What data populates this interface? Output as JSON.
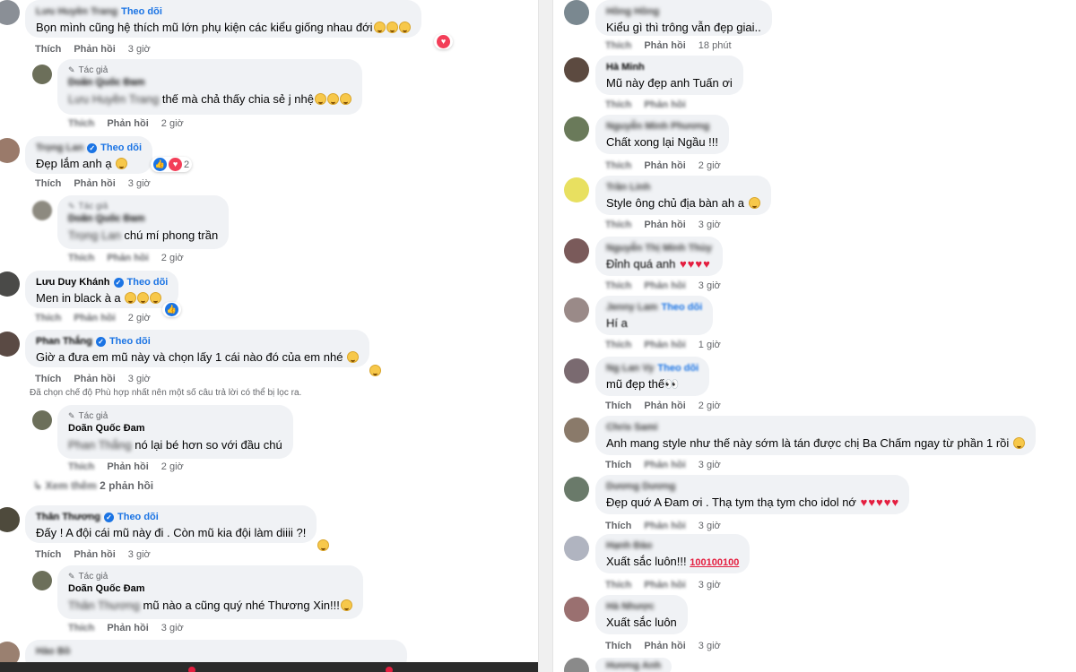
{
  "actions": {
    "like": "Thích",
    "reply": "Phản hồi"
  },
  "follow_label": "Theo dõi",
  "author_label": "Tác giả",
  "left": {
    "c1": {
      "name": "Lưu Huyền Trang",
      "text": "Bọn mình cũng hệ thích mũ lớn phụ kiện các kiểu giống nhau đới",
      "time": "3 giờ"
    },
    "r1": {
      "name": "Doãn Quốc Đam",
      "mention": "Lưu Huyền Trang",
      "text": "thế mà chả thấy chia sẻ j nhệ",
      "time": "2 giờ"
    },
    "c2": {
      "name": "Trọng Lan",
      "text": "Đẹp lắm anh ạ",
      "time": "3 giờ",
      "react_count": "2"
    },
    "r2": {
      "name": "Doãn Quốc Đam",
      "mention": "Trọng Lan",
      "text": "chú mí phong trần",
      "time": "2 giờ"
    },
    "c3": {
      "name": "Lưu Duy Khánh",
      "text": "Men in black à a",
      "time": "2 giờ"
    },
    "c4": {
      "name": "Phan Thắng",
      "text": "Giờ a đưa em mũ này và chọn lấy 1 cái nào đó của em nhé",
      "time": "3 giờ"
    },
    "note": "Đã chọn chế độ Phù hợp nhất nên một số câu trả lời có thể bị lọc ra.",
    "r4": {
      "name": "Doãn Quốc Đam",
      "mention": "Phan Thắng",
      "text": "nó lại bé hơn so với đầu chú",
      "time": "2 giờ"
    },
    "more": {
      "prefix": "Xem thêm",
      "count": "2 phản hồi"
    },
    "c5": {
      "name": "Thân Thương",
      "text": "Đấy ! A đội cái mũ này đi . Còn mũ kia đội làm diiii ?!",
      "time": "3 giờ"
    },
    "r5": {
      "name": "Doãn Quốc Đam",
      "mention": "Thân Thương",
      "text": "mũ nào a cũng quý nhé Thương Xin!!!",
      "time": "3 giờ"
    },
    "c6": {
      "name": "Hào Bồ"
    }
  },
  "right": {
    "r_c1": {
      "name": "Hồng Hồng",
      "text": "Kiểu gì thì trông vẫn đẹp giai..",
      "time": "18 phút"
    },
    "r_c2": {
      "name": "Hà Minh",
      "text": "Mũ này đẹp anh Tuấn ơi",
      "time": ""
    },
    "r_c3": {
      "name": "Nguyễn Minh Phương",
      "text": "Chất xong lại Ngầu !!!",
      "time": "2 giờ"
    },
    "r_c4": {
      "name": "Trần Linh",
      "text": "Style ông chủ địa bàn ah a",
      "time": "3 giờ"
    },
    "r_c5": {
      "name": "Nguyễn Thị Minh Thùy",
      "text": "Đỉnh quá anh",
      "time": "3 giờ"
    },
    "r_c6": {
      "name": "Jenny Lam",
      "text": "Hí a",
      "time": "1 giờ"
    },
    "r_c7": {
      "name": "Ng Lan Vy",
      "text": "mũ đẹp thế",
      "time": "2 giờ"
    },
    "r_c8": {
      "name": "Chris Sami",
      "text": "Anh mang style như thế này sớm là tán được chị Ba Chấm ngay từ phần 1 rồi",
      "time": "3 giờ"
    },
    "r_c9": {
      "name": "Dương Dương",
      "text": "Đẹp quớ A Đam ơi . Thạ tym thạ tym cho idol nớ",
      "time": "3 giờ"
    },
    "r_c10": {
      "name": "Hạnh Đào",
      "text": "Xuất sắc luôn!!!",
      "time": "3 giờ"
    },
    "r_c11": {
      "name": "Hà Nhược",
      "text": "Xuất sắc luôn",
      "time": "3 giờ"
    },
    "r_c12": {
      "name": "Hương Anh"
    }
  },
  "colors": {
    "accent": "#1b74e4",
    "bubble": "#f0f2f5",
    "muted": "#65676b",
    "heart": "#e41e3f"
  }
}
